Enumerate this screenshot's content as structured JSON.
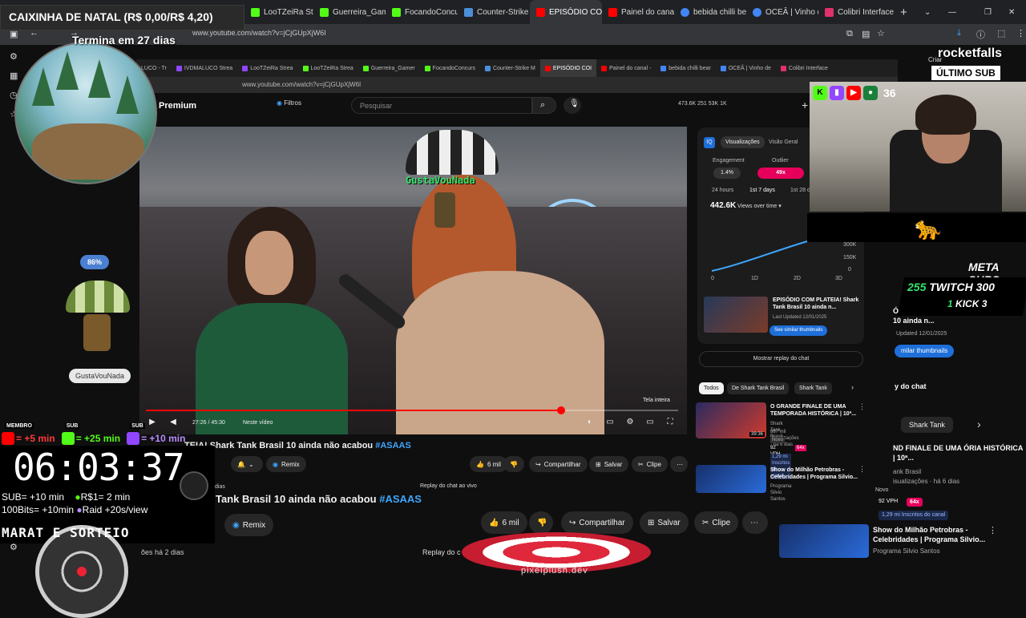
{
  "browser": {
    "tabs": [
      {
        "label": "CAIXINHA DE NATAL (R$ 0,00/R$ 4,20)",
        "color": "#9146ff"
      },
      {
        "label": "LooTZeiRa Stream",
        "color": "#53fc18"
      },
      {
        "label": "Guerreira_Gamer",
        "color": "#53fc18"
      },
      {
        "label": "FocandoConcursos",
        "color": "#53fc18"
      },
      {
        "label": "Counter-Strike M",
        "color": "#4a8fd8"
      },
      {
        "label": "EPISÓDIO COI",
        "color": "#ff0000"
      },
      {
        "label": "Painel do canal -",
        "color": "#ff0000"
      },
      {
        "label": "bebida chilli bear",
        "color": "#4285f4"
      },
      {
        "label": "OCEÂ | Vinho de",
        "color": "#4285f4"
      },
      {
        "label": "Colibri Interfaces",
        "color": "#e1306c"
      }
    ],
    "url": "www.youtube.com/watch?v=jCjGUpXjW6I"
  },
  "inner_browser": {
    "tabs": [
      "LUCO - Tr",
      "IVDMALUCO Strea",
      "LooTZeiRa Strea",
      "LooTZeiRa Strea",
      "Guerreira_Gamer",
      "FocandoConcurs",
      "Counter-Strike M",
      "EPISÓDIO COI",
      "Painel do canal -",
      "bebida chilli bear",
      "OCEÂ | Vinho de",
      "Colibri Interface"
    ],
    "url": "www.youtube.com/watch?v=jCjGUpXjW6I"
  },
  "youtube": {
    "brand": "Premium",
    "filtros_label": "Filtros",
    "search_placeholder": "Pesquisar",
    "stats": "473.6K  251  53K  1K",
    "time": "27:26 / 45:30",
    "next_video": "Neste vídeo",
    "tela_inteira": "Tela inteira",
    "progress": 0.78,
    "title_small_prefix": "TEIA! Shark Tank Brasil 10 ainda não acabou",
    "title_large_prefix": "Tank Brasil 10 ainda não acabou",
    "hashtag": "#ASAAS",
    "likes_small": "6 mil",
    "likes_large": "6 mil",
    "share": "Compartilhar",
    "save": "Salvar",
    "clip": "Clipe",
    "remix": "Remix",
    "dias_small": "dias",
    "dias_large": "ões  há 2 dias",
    "live_replay": "Replay do chat ao vivo",
    "live_replay_large": "Replay do c"
  },
  "insights": {
    "tab_views": "Visualizações",
    "tab_overview": "Visão Geral",
    "engagement_label": "Engagement",
    "engagement_value": "1.4%",
    "outlier_label": "Outlier",
    "outlier_value": "49x",
    "range_24h": "24 hours",
    "range_7d": "1st 7 days",
    "range_28d": "1st 28 d",
    "views_value": "442.6K",
    "views_label": "Views over time",
    "chart_ticks": [
      "300K",
      "150K",
      "0"
    ],
    "x_ticks": [
      "0",
      "1D",
      "2D",
      "3D"
    ],
    "card_title": "EPISÓDIO COM PLATEIA! Shark Tank Brasil 10 ainda n...",
    "card_date": "Last Updated 12/01/2025",
    "similar_btn": "See similar thumbnails",
    "chat_replay": "Mostrar replay do chat",
    "chips": [
      "Todos",
      "De Shark Tank Brasil",
      "Shark Tank"
    ],
    "rec1_title": "O GRANDE FINALE DE UMA TEMPORADA HISTÓRICA | 10ª...",
    "rec1_channel": "Shark Tank Brasil",
    "rec1_meta": "887 mil visualizações · há 6 dias",
    "rec1_badge": "Novo",
    "rec1_vph": "92 VPH",
    "rec1_outlier": "64x",
    "rec1_subs": "1,29 mi Inscritos do canal",
    "rec2_title": "Show do Milhão Petrobras - Celebridades | Programa Silvio...",
    "rec2_channel": "Programa Silvio Santos",
    "rec1_thumb_text": "39:36"
  },
  "right_zoom": {
    "card_title": "ÓDIO COM PLATEIA! k Tank Brasil 10 ainda n...",
    "card_date": "Updated 12/01/2025",
    "similar_btn": "milar thumbnails",
    "chat": "y do chat",
    "chip": "Shark Tank",
    "rec1_title": "ND FINALE DE UMA ÓRIA HISTÓRICA | 10ª...",
    "rec1_meta1": "ank Brasil",
    "rec1_meta2": "isualizações · há 6 dias",
    "rec1_badge": "Novo",
    "vph": "92 VPH",
    "outlier": "64x",
    "subs": "1,29 mi Inscritos do canal",
    "rec2_title": "Show do Milhão Petrobras - Celebridades | Programa Silvio...",
    "rec2_channel": "Programa Silvio Santos"
  },
  "overlay": {
    "donation": "CAIXINHA DE NATAL (R$ 0,00/R$ 4,20)",
    "termina": "Termina em 27 dias",
    "percent": "86%",
    "username_left": "GustaVouNada",
    "username_top": "GustaVouNada",
    "rocket": "rocketfalls",
    "criar": "Criar",
    "ultimo_sub": "ÚLTIMO SUB",
    "cam_count": "36",
    "meta_subs": "META SUBS",
    "meta_twitch_left": "255",
    "meta_twitch_label": "TWITCH",
    "meta_twitch_right": "300",
    "meta_kick_left": "1",
    "meta_kick_label": "KICK",
    "meta_kick_right": "3",
    "pixelplush": "pixelplush.dev"
  },
  "subathon": {
    "membro_label": "MEMBRO",
    "membro_value": "= +5 min",
    "kick_label": "SUB",
    "kick_value": "= +25 min",
    "twitch_label": "SUB",
    "twitch_value": "= +10 min",
    "timer": "06:03:37",
    "rate1_left": "SUB= +10 min",
    "rate1_right": "R$1= 2 min",
    "rate2_left": "100Bits= +10min",
    "rate2_right": "Raid +20s/view",
    "banner": "MARAT   E SORTEIO"
  },
  "colors": {
    "youtube_red": "#ff0000",
    "kick_green": "#53fc18",
    "twitch_purple": "#9146ff",
    "accent_blue": "#3ea6ff",
    "outlier_pink": "#e6005c"
  }
}
